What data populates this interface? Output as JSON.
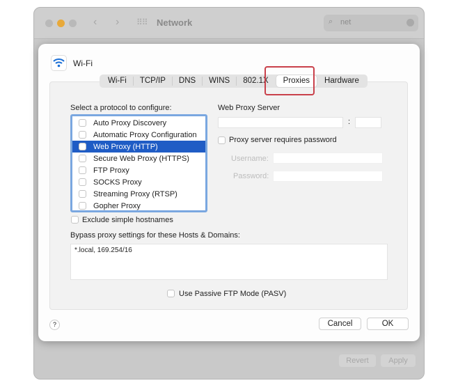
{
  "window": {
    "title": "Network",
    "search_value": "net",
    "revert_label": "Revert",
    "apply_label": "Apply"
  },
  "sheet": {
    "service_name": "Wi-Fi",
    "tabs": [
      "Wi-Fi",
      "TCP/IP",
      "DNS",
      "WINS",
      "802.1X",
      "Proxies",
      "Hardware"
    ],
    "selected_tab": "Proxies",
    "protocol_label": "Select a protocol to configure:",
    "protocols": [
      {
        "label": "Auto Proxy Discovery",
        "checked": false
      },
      {
        "label": "Automatic Proxy Configuration",
        "checked": false
      },
      {
        "label": "Web Proxy (HTTP)",
        "checked": false,
        "selected": true
      },
      {
        "label": "Secure Web Proxy (HTTPS)",
        "checked": false
      },
      {
        "label": "FTP Proxy",
        "checked": false
      },
      {
        "label": "SOCKS Proxy",
        "checked": false
      },
      {
        "label": "Streaming Proxy (RTSP)",
        "checked": false
      },
      {
        "label": "Gopher Proxy",
        "checked": false
      }
    ],
    "server_label": "Web Proxy Server",
    "server_value": "",
    "port_value": "",
    "colon": ":",
    "requires_password_label": "Proxy server requires password",
    "username_label": "Username:",
    "password_label": "Password:",
    "exclude_label": "Exclude simple hostnames",
    "bypass_label": "Bypass proxy settings for these Hosts & Domains:",
    "bypass_value": "*.local, 169.254/16",
    "pasv_label": "Use Passive FTP Mode (PASV)",
    "help_label": "?",
    "cancel_label": "Cancel",
    "ok_label": "OK"
  },
  "colors": {
    "selection": "#1f5cc5",
    "highlight": "#c9404a",
    "focus": "#7aa7e0"
  }
}
